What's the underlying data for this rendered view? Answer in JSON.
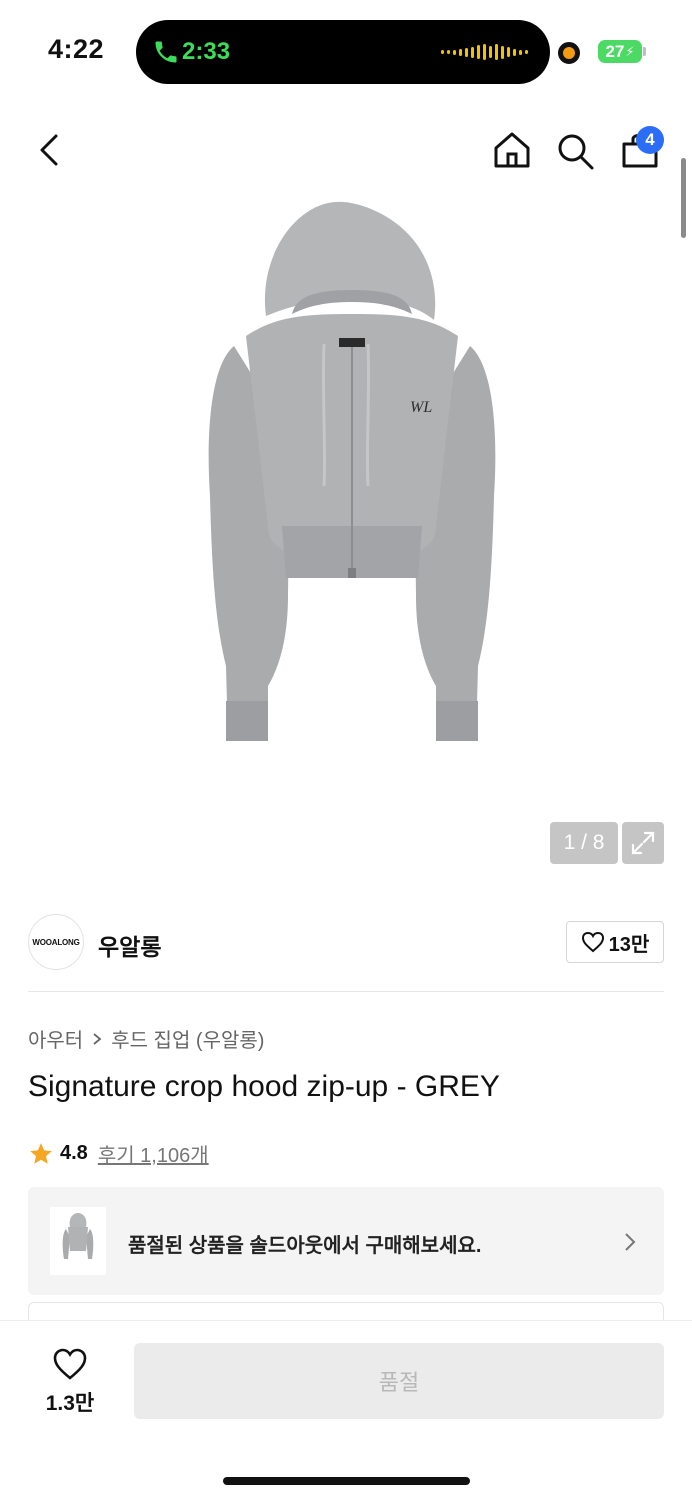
{
  "status_bar": {
    "time": "4:22",
    "call_time": "2:33",
    "battery": "27"
  },
  "nav": {
    "cart_count": "4"
  },
  "gallery": {
    "counter": "1 / 8"
  },
  "brand": {
    "logo_text": "WOOALONG",
    "name": "우알롱",
    "likes": "13만"
  },
  "product": {
    "breadcrumb": [
      "아우터",
      "후드 집업 (우알롱)"
    ],
    "title": "Signature crop hood zip-up - GREY",
    "rating": "4.8",
    "reviews": "후기 1,106개"
  },
  "resale": {
    "text": "품절된 상품을 솔드아웃에서 구매해보세요."
  },
  "bottom": {
    "wish_count": "1.3만",
    "buy_label": "품절"
  },
  "colors": {
    "badge": "#2b6ef5",
    "star": "#f5a623",
    "call_green": "#3ddc5a",
    "battery_green": "#4cd964"
  }
}
